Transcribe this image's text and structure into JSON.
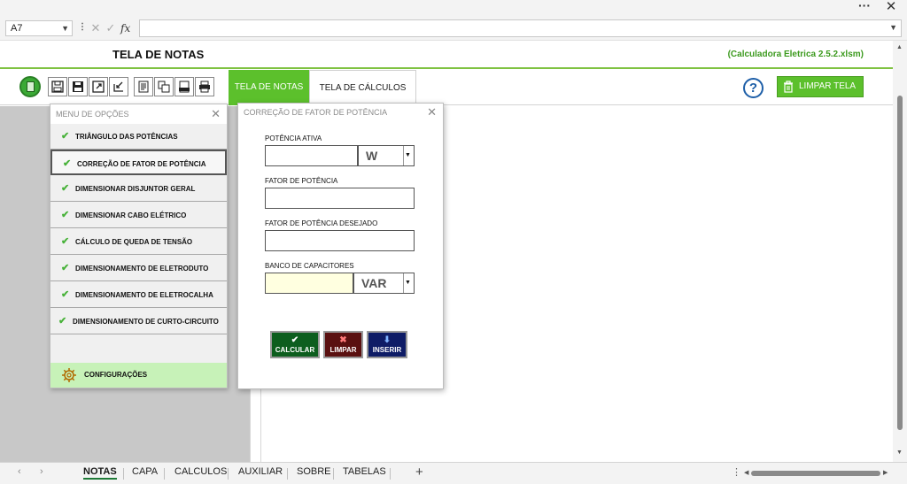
{
  "formula_bar": {
    "name_box": "A7",
    "fx": "fx",
    "formula_value": ""
  },
  "header": {
    "sheet_title": "TELA DE NOTAS",
    "file_name": "(Calculadora Eletrica 2.5.2.xlsm)"
  },
  "toolbar": {
    "tab_notas": "TELA DE NOTAS",
    "tab_calculos": "TELA DE CÁLCULOS",
    "help": "?",
    "clear_label": "LIMPAR TELA"
  },
  "menu": {
    "title": "MENU DE OPÇÕES",
    "items": [
      {
        "label": "TRIÂNGULO DAS POTÊNCIAS"
      },
      {
        "label": "CORREÇÃO DE FATOR DE POTÊNCIA"
      },
      {
        "label": "DIMENSIONAR DISJUNTOR GERAL"
      },
      {
        "label": "DIMENSIONAR CABO ELÉTRICO"
      },
      {
        "label": "CÁLCULO DE QUEDA DE TENSÃO"
      },
      {
        "label": "DIMENSIONAMENTO DE ELETRODUTO"
      },
      {
        "label": "DIMENSIONAMENTO DE ELETROCALHA"
      },
      {
        "label": "DIMENSIONAMENTO DE CURTO-CIRCUITO"
      }
    ],
    "config_label": "CONFIGURAÇÕES"
  },
  "dialog": {
    "title": "CORREÇÃO DE FATOR DE POTÊNCIA",
    "potencia_ativa_label": "POTÊNCIA ATIVA",
    "potencia_ativa_value": "",
    "potencia_unit": "W",
    "fator_label": "FATOR DE POTÊNCIA",
    "fator_value": "",
    "fator_desejado_label": "FATOR DE POTÊNCIA DESEJADO",
    "fator_desejado_value": "",
    "banco_label": "BANCO DE CAPACITORES",
    "banco_value": "",
    "banco_unit": "VAR",
    "btn_calcular": "CALCULAR",
    "btn_limpar": "LIMPAR",
    "btn_inserir": "INSERIR"
  },
  "sheets": {
    "tabs": [
      "NOTAS",
      "CAPA",
      "CALCULOS",
      "AUXILIAR",
      "SOBRE",
      "TABELAS"
    ],
    "active": "NOTAS",
    "add": "+"
  },
  "colors": {
    "accent_green": "#5cc02c",
    "header_line": "#7fc241",
    "file_name_green": "#3c9a1e",
    "calc_button": "#0d5e1e",
    "clear_button": "#5a1010",
    "insert_button": "#0e1c66",
    "config_bg": "#c7f2b8"
  }
}
